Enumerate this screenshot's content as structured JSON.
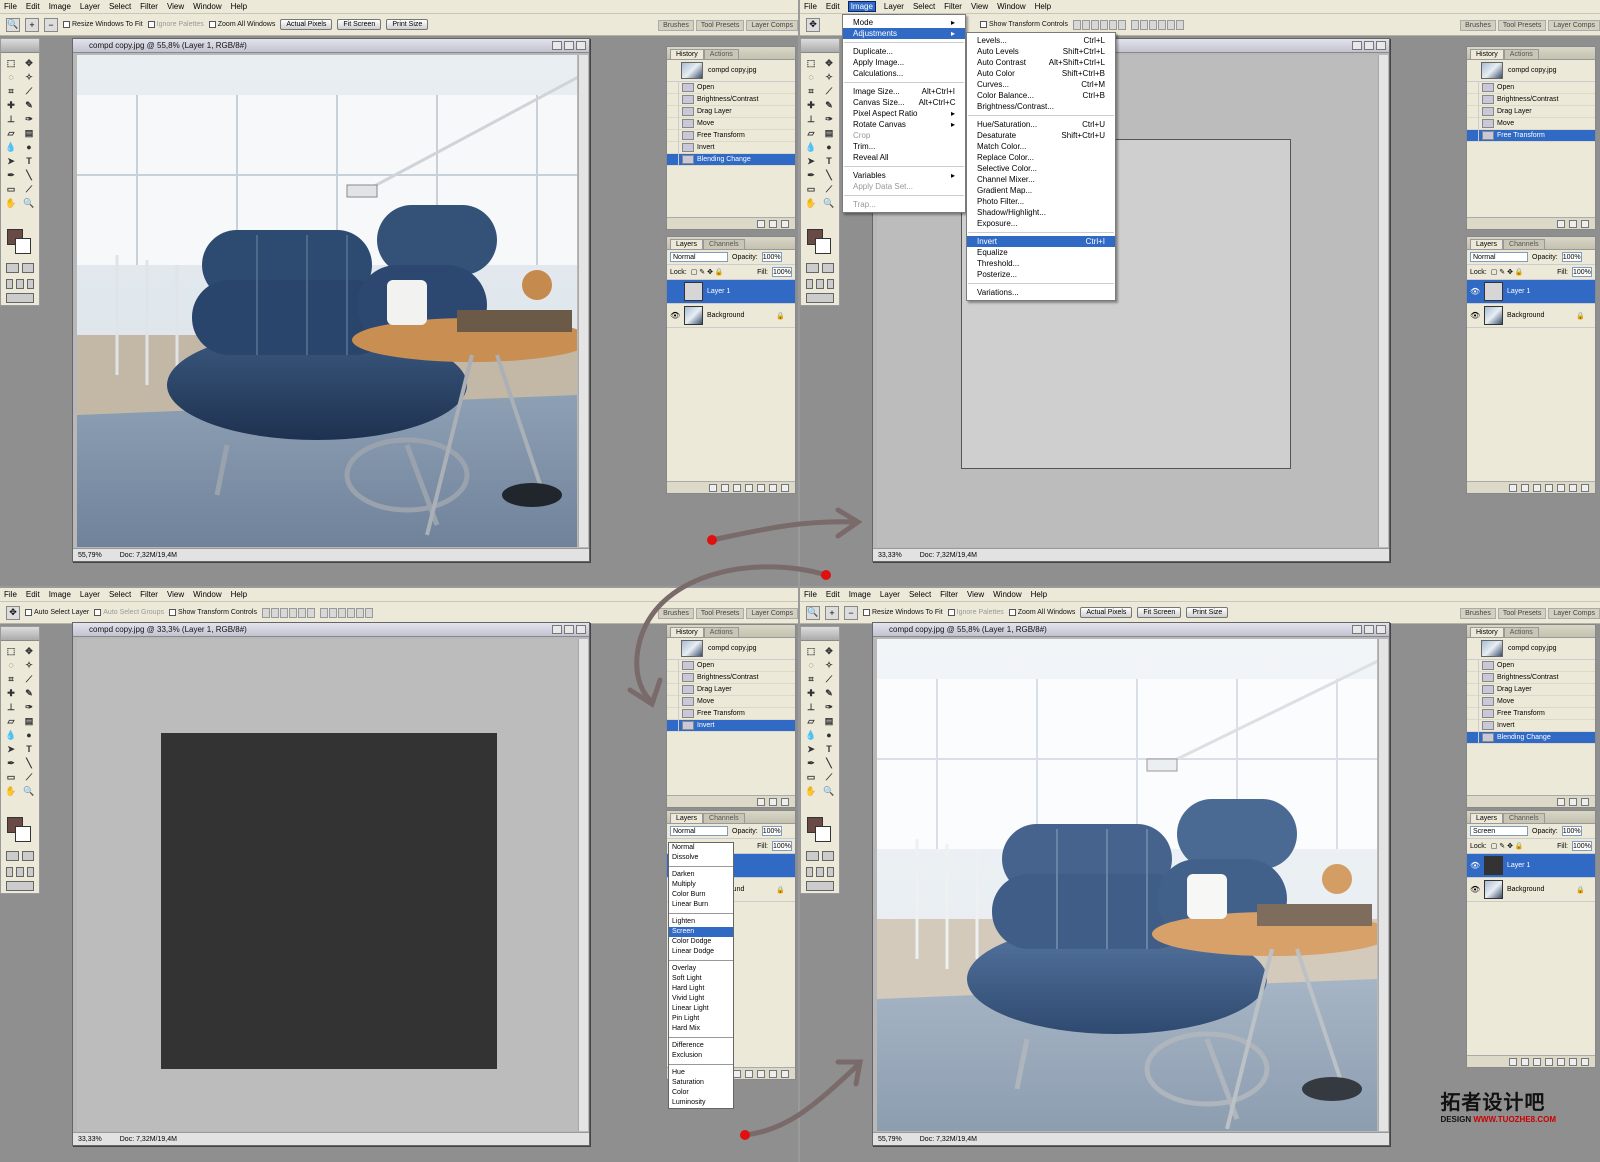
{
  "menubar": [
    "File",
    "Edit",
    "Image",
    "Layer",
    "Select",
    "Filter",
    "View",
    "Window",
    "Help"
  ],
  "options_zoom": {
    "resize": "Resize Windows To Fit",
    "ignore": "Ignore Palettes",
    "zoom_all": "Zoom All Windows",
    "actual": "Actual Pixels",
    "fit": "Fit Screen",
    "print": "Print Size"
  },
  "options_move": {
    "auto_layer": "Auto Select Layer",
    "auto_groups": "Auto Select Groups",
    "show_transform": "Show Transform Controls"
  },
  "well_tabs": [
    "Brushes",
    "Tool Presets",
    "Layer Comps"
  ],
  "doc": {
    "title_55": "compd copy.jpg @ 55,8% (Layer 1, RGB/8#)",
    "title_33": "compd copy.jpg @ 33,3% (Layer 1, RGB/8#)",
    "zoom_55": "55,79%",
    "zoom_33": "33,33%",
    "doc_size": "Doc: 7,32M/19,4M"
  },
  "history": {
    "tabs": [
      "History",
      "Actions"
    ],
    "snapshot": "compd copy.jpg",
    "steps": [
      "Open",
      "Brightness/Contrast",
      "Drag Layer",
      "Move",
      "Free Transform",
      "Invert",
      "Blending Change"
    ]
  },
  "layers": {
    "tabs": [
      "Layers",
      "Channels"
    ],
    "mode_normal": "Normal",
    "mode_screen": "Screen",
    "opacity_label": "Opacity:",
    "opacity": "100%",
    "lock_label": "Lock:",
    "fill_label": "Fill:",
    "fill": "100%",
    "layer1": "Layer 1",
    "background": "Background"
  },
  "image_menu": {
    "items": [
      {
        "label": "Mode",
        "sc": "▸"
      },
      {
        "label": "Adjustments",
        "sc": "▸"
      },
      {
        "sep": true
      },
      {
        "label": "Duplicate...",
        "sc": ""
      },
      {
        "label": "Apply Image...",
        "sc": ""
      },
      {
        "label": "Calculations...",
        "sc": ""
      },
      {
        "sep": true
      },
      {
        "label": "Image Size...",
        "sc": "Alt+Ctrl+I"
      },
      {
        "label": "Canvas Size...",
        "sc": "Alt+Ctrl+C"
      },
      {
        "label": "Pixel Aspect Ratio",
        "sc": "▸"
      },
      {
        "label": "Rotate Canvas",
        "sc": "▸"
      },
      {
        "label": "Crop",
        "sc": ""
      },
      {
        "label": "Trim...",
        "sc": ""
      },
      {
        "label": "Reveal All",
        "sc": ""
      },
      {
        "sep": true
      },
      {
        "label": "Variables",
        "sc": "▸"
      },
      {
        "label": "Apply Data Set...",
        "sc": ""
      },
      {
        "sep": true
      },
      {
        "label": "Trap...",
        "sc": ""
      }
    ]
  },
  "adjust_menu": {
    "items": [
      {
        "label": "Levels...",
        "sc": "Ctrl+L"
      },
      {
        "label": "Auto Levels",
        "sc": "Shift+Ctrl+L"
      },
      {
        "label": "Auto Contrast",
        "sc": "Alt+Shift+Ctrl+L"
      },
      {
        "label": "Auto Color",
        "sc": "Shift+Ctrl+B"
      },
      {
        "label": "Curves...",
        "sc": "Ctrl+M"
      },
      {
        "label": "Color Balance...",
        "sc": "Ctrl+B"
      },
      {
        "label": "Brightness/Contrast...",
        "sc": ""
      },
      {
        "sep": true
      },
      {
        "label": "Hue/Saturation...",
        "sc": "Ctrl+U"
      },
      {
        "label": "Desaturate",
        "sc": "Shift+Ctrl+U"
      },
      {
        "label": "Match Color...",
        "sc": ""
      },
      {
        "label": "Replace Color...",
        "sc": ""
      },
      {
        "label": "Selective Color...",
        "sc": ""
      },
      {
        "label": "Channel Mixer...",
        "sc": ""
      },
      {
        "label": "Gradient Map...",
        "sc": ""
      },
      {
        "label": "Photo Filter...",
        "sc": ""
      },
      {
        "label": "Shadow/Highlight...",
        "sc": ""
      },
      {
        "label": "Exposure...",
        "sc": ""
      },
      {
        "sep": true
      },
      {
        "label": "Invert",
        "sc": "Ctrl+I"
      },
      {
        "label": "Equalize",
        "sc": ""
      },
      {
        "label": "Threshold...",
        "sc": ""
      },
      {
        "label": "Posterize...",
        "sc": ""
      },
      {
        "sep": true
      },
      {
        "label": "Variations...",
        "sc": ""
      }
    ]
  },
  "blend_modes": [
    [
      "Normal",
      "Dissolve"
    ],
    [
      "Darken",
      "Multiply",
      "Color Burn",
      "Linear Burn"
    ],
    [
      "Lighten",
      "Screen",
      "Color Dodge",
      "Linear Dodge"
    ],
    [
      "Overlay",
      "Soft Light",
      "Hard Light",
      "Vivid Light",
      "Linear Light",
      "Pin Light",
      "Hard Mix"
    ],
    [
      "Difference",
      "Exclusion"
    ],
    [
      "Hue",
      "Saturation",
      "Color",
      "Luminosity"
    ]
  ],
  "watermark": {
    "cn": "拓者设计吧",
    "en": "DESIGN",
    "url": "WWW.TUOZHE8.COM"
  }
}
